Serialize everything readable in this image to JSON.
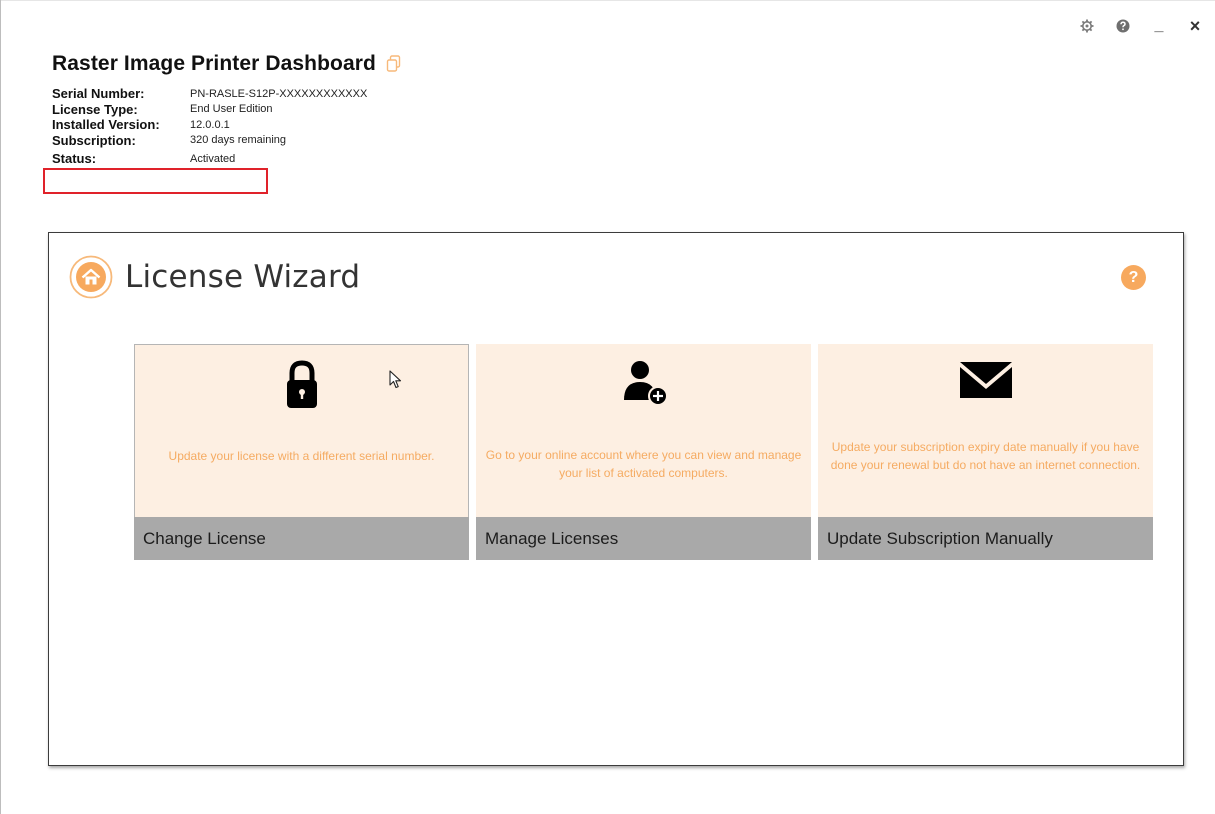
{
  "window": {
    "controls": {
      "settings_icon": "gear-icon",
      "help_icon": "question-icon",
      "minimize_label": "_",
      "close_label": "×"
    }
  },
  "header": {
    "title": "Raster Image Printer Dashboard",
    "copy_icon": "copy-icon",
    "info": [
      {
        "label": "Serial Number:",
        "value": "PN-RASLE-S12P-XXXXXXXXXXXX"
      },
      {
        "label": "License Type:",
        "value": "End User Edition"
      },
      {
        "label": "Installed Version:",
        "value": "12.0.0.1"
      },
      {
        "label": "Subscription:",
        "value": "320 days remaining"
      },
      {
        "label": "Status:",
        "value": "Activated"
      }
    ]
  },
  "wizard": {
    "title": "License Wizard",
    "help_label": "?",
    "cards": [
      {
        "icon": "lock-icon",
        "description": "Update your license with a different serial number.",
        "label": "Change License"
      },
      {
        "icon": "add-user-icon",
        "description": "Go to your online account where you can view and manage your list of activated computers.",
        "label": "Manage Licenses"
      },
      {
        "icon": "envelope-icon",
        "description": "Update your subscription expiry date manually if you have done your renewal but do not have an internet connection.",
        "label": "Update Subscription Manually"
      }
    ]
  },
  "colors": {
    "accent": "#f7a95e",
    "card_background": "#fdefe2",
    "card_footer": "#a9a9a9",
    "highlight": "#e0222a"
  }
}
